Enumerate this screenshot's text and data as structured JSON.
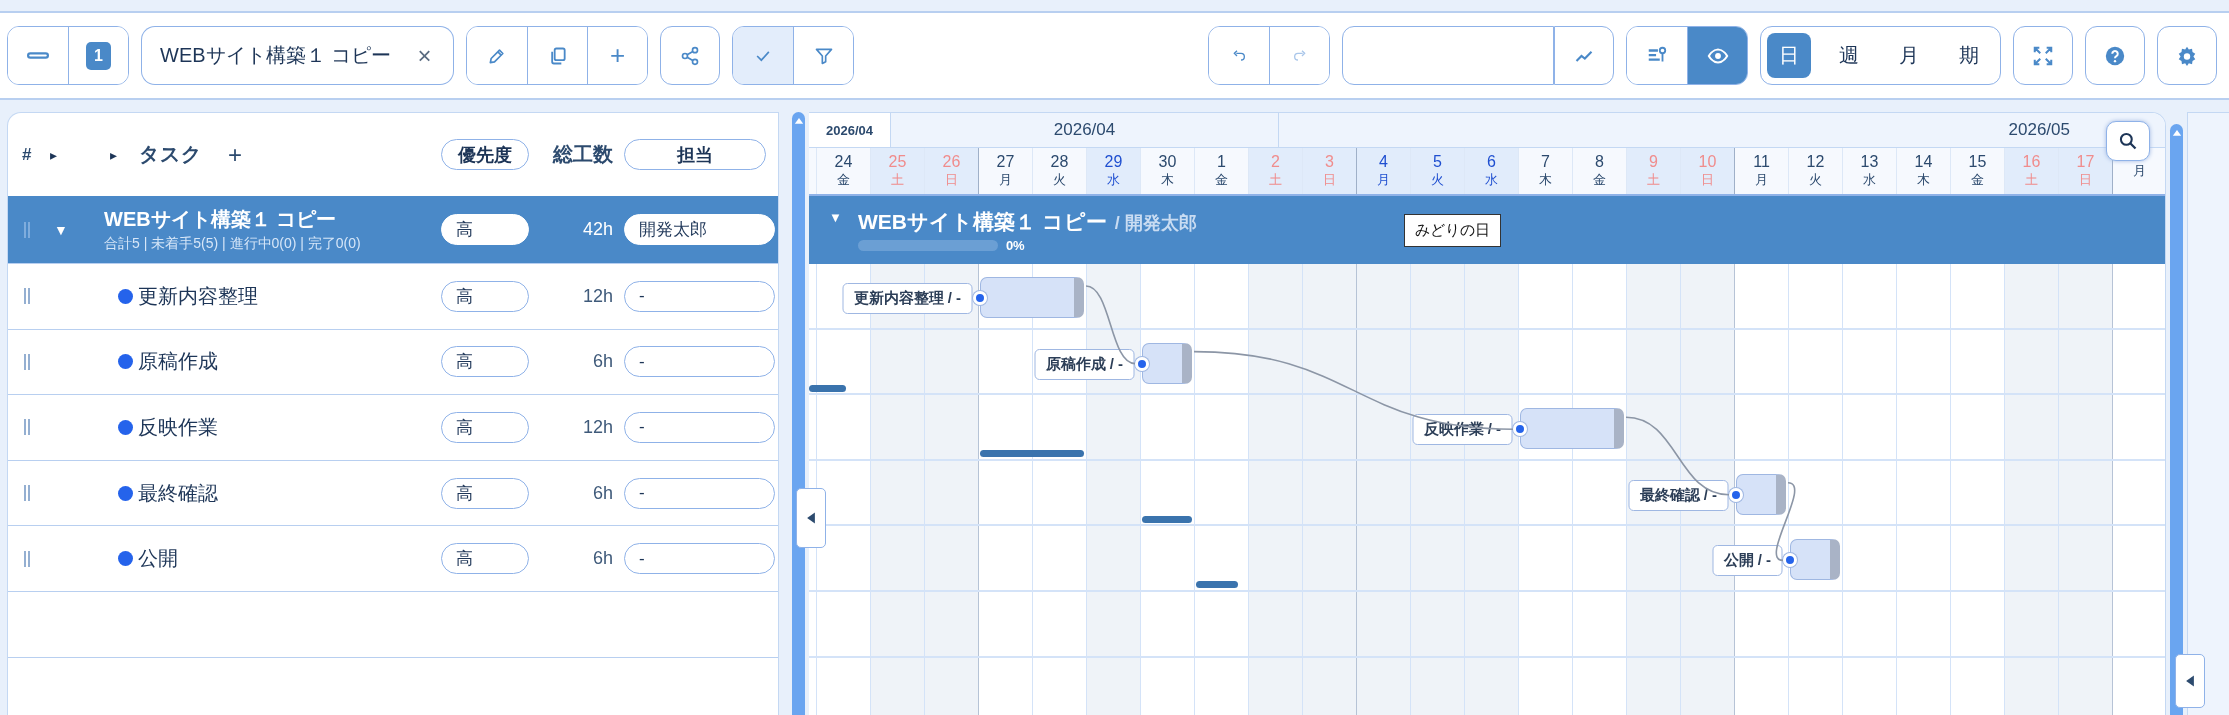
{
  "toolbar": {
    "page_number": "1",
    "title_field": "WEBサイト構築１ コピー",
    "clear_label": "×",
    "add_label": "+",
    "check_on": true,
    "filter_on": false,
    "undo_disabled": false,
    "redo_disabled": true,
    "view_toggles": [
      {
        "kind": "columns",
        "selected": false
      },
      {
        "kind": "eye",
        "selected": true
      }
    ],
    "scales": [
      {
        "label": "日",
        "selected": true
      },
      {
        "label": "週",
        "selected": false
      },
      {
        "label": "月",
        "selected": false
      },
      {
        "label": "期",
        "selected": false
      }
    ]
  },
  "task_list": {
    "header": {
      "hash": "#",
      "expand_marks": [
        "▸",
        "▸"
      ],
      "task": "タスク",
      "add": "+",
      "priority": "優先度",
      "effort": "総工数",
      "assignee": "担当"
    },
    "group": {
      "toggle": "▼",
      "title": "WEBサイト構築１ コピー",
      "summary": "合計5 | 未着手5(5) | 進行中0(0) | 完了0(0)",
      "priority": "高",
      "effort": "42h",
      "assignee": "開発太郎"
    },
    "tasks": [
      {
        "name": "更新内容整理",
        "color": "#2563eb",
        "priority": "高",
        "effort": "12h",
        "assignee": "-"
      },
      {
        "name": "原稿作成",
        "color": "#2563eb",
        "priority": "高",
        "effort": "6h",
        "assignee": "-"
      },
      {
        "name": "反映作業",
        "color": "#2563eb",
        "priority": "高",
        "effort": "12h",
        "assignee": "-"
      },
      {
        "name": "最終確認",
        "color": "#2563eb",
        "priority": "高",
        "effort": "6h",
        "assignee": "-"
      },
      {
        "name": "公開",
        "color": "#2563eb",
        "priority": "高",
        "effort": "6h",
        "assignee": "-"
      }
    ]
  },
  "gantt": {
    "months": [
      {
        "label": "2026/04",
        "kind": "sticky"
      },
      {
        "label": "2026/04",
        "kind": "first"
      },
      {
        "label": "2026/05",
        "kind": "second"
      }
    ],
    "days": [
      {
        "day": "24",
        "weekday": "金",
        "kind": "weekday"
      },
      {
        "day": "25",
        "weekday": "土",
        "kind": "saturday"
      },
      {
        "day": "26",
        "weekday": "日",
        "kind": "sunday"
      },
      {
        "day": "27",
        "weekday": "月",
        "kind": "weekday",
        "week_start": true
      },
      {
        "day": "28",
        "weekday": "火",
        "kind": "weekday"
      },
      {
        "day": "29",
        "weekday": "水",
        "kind": "holiday"
      },
      {
        "day": "30",
        "weekday": "木",
        "kind": "weekday"
      },
      {
        "day": "1",
        "weekday": "金",
        "kind": "weekday"
      },
      {
        "day": "2",
        "weekday": "土",
        "kind": "saturday"
      },
      {
        "day": "3",
        "weekday": "日",
        "kind": "sunday"
      },
      {
        "day": "4",
        "weekday": "月",
        "kind": "holiday",
        "week_start": true,
        "tooltip": "みどりの日"
      },
      {
        "day": "5",
        "weekday": "火",
        "kind": "holiday"
      },
      {
        "day": "6",
        "weekday": "水",
        "kind": "holiday"
      },
      {
        "day": "7",
        "weekday": "木",
        "kind": "weekday"
      },
      {
        "day": "8",
        "weekday": "金",
        "kind": "weekday"
      },
      {
        "day": "9",
        "weekday": "土",
        "kind": "saturday"
      },
      {
        "day": "10",
        "weekday": "日",
        "kind": "sunday"
      },
      {
        "day": "11",
        "weekday": "月",
        "kind": "weekday",
        "week_start": true
      },
      {
        "day": "12",
        "weekday": "火",
        "kind": "weekday"
      },
      {
        "day": "13",
        "weekday": "水",
        "kind": "weekday"
      },
      {
        "day": "14",
        "weekday": "木",
        "kind": "weekday"
      },
      {
        "day": "15",
        "weekday": "金",
        "kind": "weekday"
      },
      {
        "day": "16",
        "weekday": "土",
        "kind": "saturday"
      },
      {
        "day": "17",
        "weekday": "日",
        "kind": "sunday"
      },
      {
        "weekday": "月",
        "kind": "weekday",
        "week_start": true
      }
    ],
    "summary": {
      "toggle": "▼",
      "title": "WEBサイト構築１ コピー",
      "owner": "/ 開発太郎",
      "level": 0,
      "progress_label": "0%"
    },
    "bars": [
      {
        "label": "更新内容整理 / -"
      },
      {
        "label": "原稿作成 / -"
      },
      {
        "label": "反映作業 / -"
      },
      {
        "label": "最終確認 / -"
      },
      {
        "label": "公開 / -"
      }
    ]
  }
}
